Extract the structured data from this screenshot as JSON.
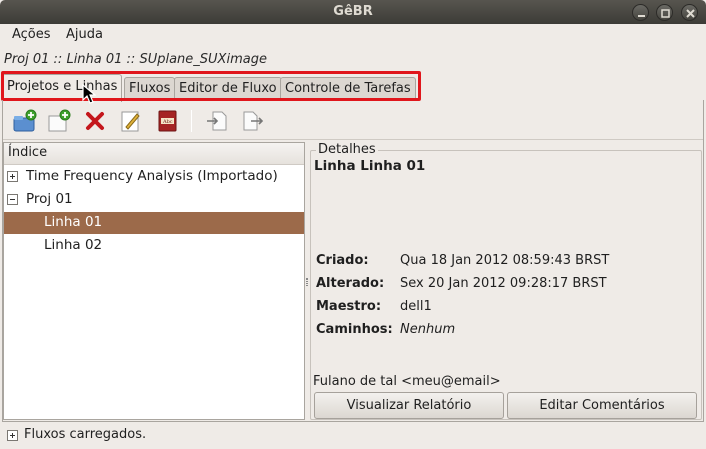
{
  "window": {
    "title": "GêBR"
  },
  "menu": {
    "items": [
      {
        "label": "Ações"
      },
      {
        "label": "Ajuda"
      }
    ]
  },
  "breadcrumb": "Proj 01 :: Linha 01 :: SUplane_SUXimage",
  "tabs": [
    {
      "label": "Projetos e Linhas",
      "active": true
    },
    {
      "label": "Fluxos"
    },
    {
      "label": "Editor de Fluxo"
    },
    {
      "label": "Controle de Tarefas"
    }
  ],
  "toolbar": {
    "icons": [
      "new-project-icon",
      "new-line-icon",
      "delete-icon",
      "edit-properties-icon",
      "dictionary-icon",
      "import-icon",
      "export-icon"
    ]
  },
  "tree": {
    "header": "Índice",
    "rows": [
      {
        "label": "Time Frequency Analysis (Importado)",
        "expander": "plus"
      },
      {
        "label": "Proj 01",
        "expander": "minus"
      },
      {
        "label": "Linha 01",
        "selected": true
      },
      {
        "label": "Linha 02"
      }
    ]
  },
  "details": {
    "legend": "Detalhes",
    "title": "Linha Linha 01",
    "fields": [
      {
        "label": "Criado:",
        "value": "Qua 18 Jan 2012 08:59:43 BRST"
      },
      {
        "label": "Alterado:",
        "value": "Sex 20 Jan 2012 09:28:17 BRST"
      },
      {
        "label": "Maestro:",
        "value": "dell1"
      },
      {
        "label": "Caminhos:",
        "value": "Nenhum"
      }
    ],
    "author": "Fulano de tal <meu@email>",
    "buttons": {
      "report": "Visualizar Relatório",
      "comments": "Editar Comentários"
    }
  },
  "status": {
    "text": "Fluxos carregados."
  },
  "colors": {
    "highlight": "#e0161c",
    "selection": "#9c6a4a"
  }
}
